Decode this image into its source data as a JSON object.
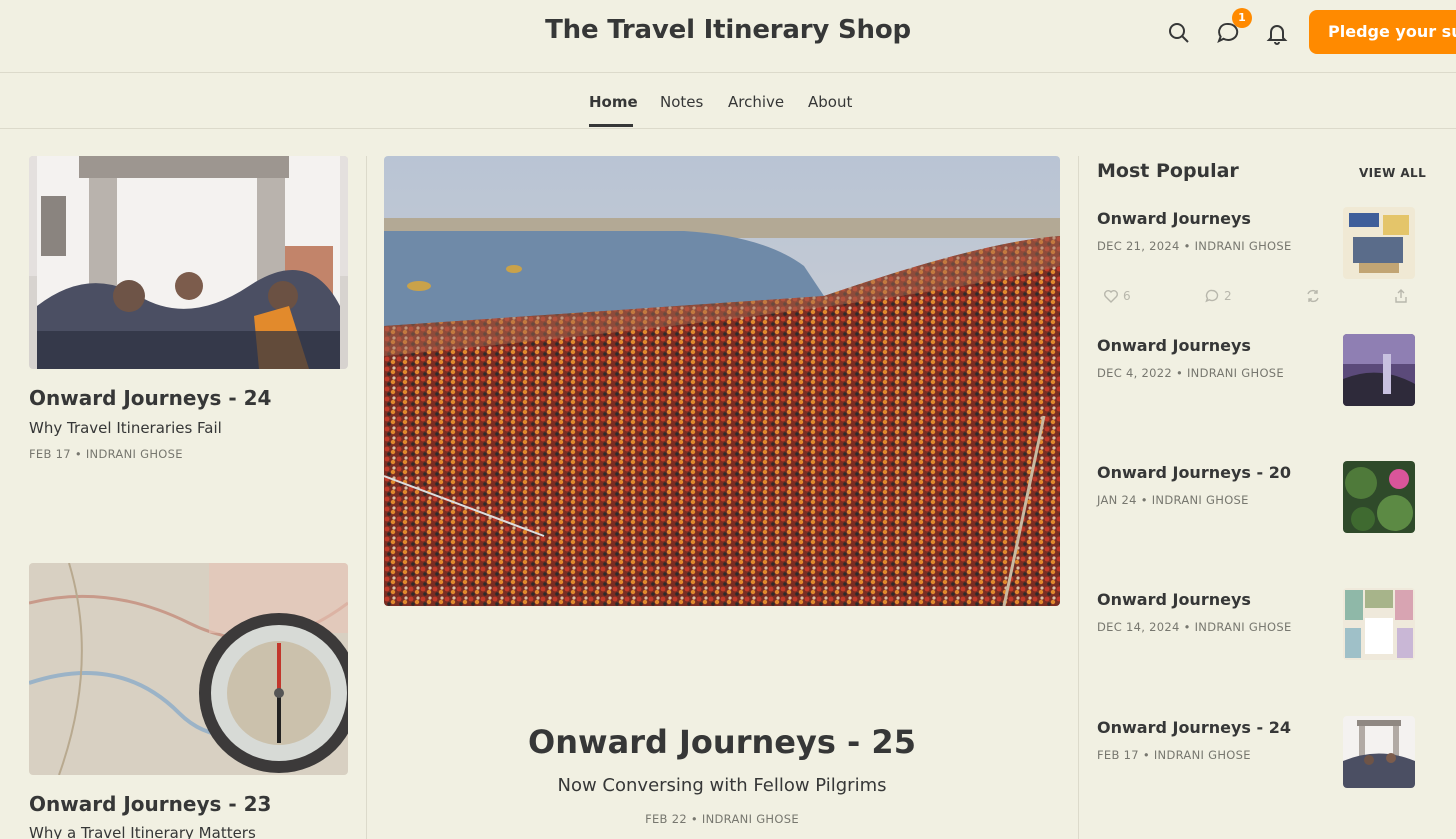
{
  "header": {
    "site_title": "The Travel Itinerary Shop",
    "notification_count": "1",
    "pledge_label": "Pledge your support",
    "icons": [
      "search-icon",
      "chat-icon",
      "bell-icon"
    ],
    "accent_color": "#ff8a00"
  },
  "nav": {
    "items": [
      {
        "label": "Home",
        "active": true
      },
      {
        "label": "Notes"
      },
      {
        "label": "Archive"
      },
      {
        "label": "About"
      }
    ]
  },
  "left_posts": [
    {
      "title": "Onward Journeys - 24",
      "subtitle": "Why Travel Itineraries Fail",
      "meta": "FEB 17 • INDRANI GHOSE"
    },
    {
      "title": "Onward Journeys - 23",
      "subtitle": "Why a Travel Itinerary Matters"
    }
  ],
  "hero": {
    "title": "Onward Journeys - 25",
    "subtitle": "Now Conversing with Fellow Pilgrims",
    "meta": "FEB 22 • INDRANI GHOSE"
  },
  "most_popular": {
    "heading": "Most Popular",
    "view_all": "VIEW ALL",
    "items": [
      {
        "title": "Onward Journeys",
        "meta": "DEC 21, 2024 • INDRANI GHOSE",
        "likes": "6",
        "comments": "2"
      },
      {
        "title": "Onward Journeys",
        "meta": "DEC 4, 2022 • INDRANI GHOSE"
      },
      {
        "title": "Onward Journeys - 20",
        "meta": "JAN 24 • INDRANI GHOSE"
      },
      {
        "title": "Onward Journeys",
        "meta": "DEC 14, 2024 • INDRANI GHOSE"
      },
      {
        "title": "Onward Journeys - 24",
        "meta": "FEB 17 • INDRANI GHOSE"
      }
    ]
  }
}
